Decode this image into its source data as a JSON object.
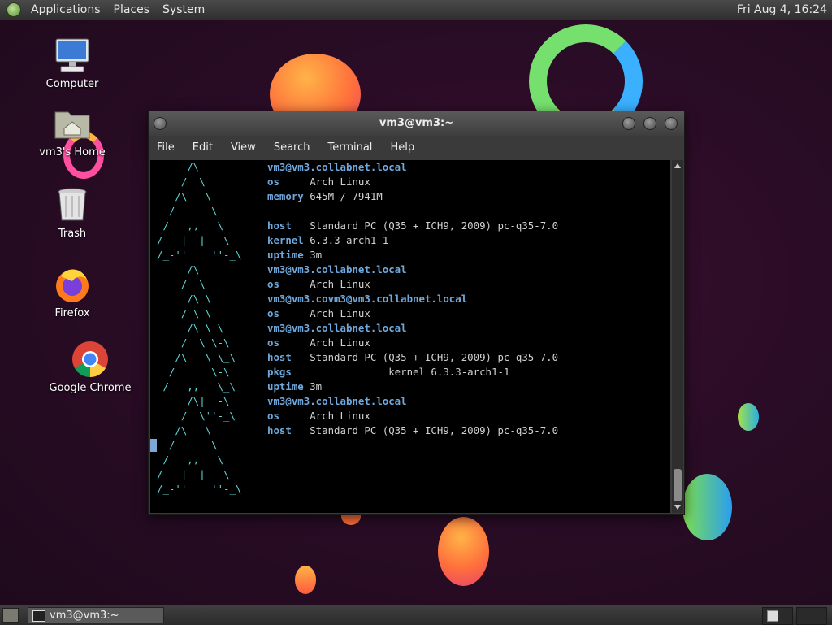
{
  "top_panel": {
    "menus": [
      "Applications",
      "Places",
      "System"
    ],
    "clock": "Fri Aug  4, 16:24"
  },
  "desktop_icons": [
    {
      "label": "Computer",
      "icon": "computer-icon"
    },
    {
      "label": "vm3's Home",
      "icon": "home-folder-icon"
    },
    {
      "label": "Trash",
      "icon": "trash-icon"
    },
    {
      "label": "Firefox",
      "icon": "firefox-icon"
    },
    {
      "label": "Google Chrome",
      "icon": "chrome-icon"
    }
  ],
  "window": {
    "title": "vm3@vm3:~",
    "menus": [
      "File",
      "Edit",
      "View",
      "Search",
      "Terminal",
      "Help"
    ]
  },
  "terminal_lines": [
    {
      "art": "     /\\",
      "key": "vm3@vm3.collabnet.local",
      "val": ""
    },
    {
      "art": "    /  \\",
      "key": "os",
      "val": "     Arch Linux"
    },
    {
      "art": "   /\\   \\",
      "key": "memory",
      "val": " 645M / 7941M"
    },
    {
      "art": "  /      \\",
      "key": "",
      "val": ""
    },
    {
      "art": " /   ,,   \\",
      "key": "host",
      "val": "   Standard PC (Q35 + ICH9, 2009) pc-q35-7.0"
    },
    {
      "art": "/   |  |  -\\",
      "key": "kernel",
      "val": " 6.3.3-arch1-1"
    },
    {
      "art": "/_-''    ''-_\\",
      "key": "uptime",
      "val": " 3m"
    },
    {
      "art": "     /\\",
      "key": "vm3@vm3.collabnet.local",
      "val": ""
    },
    {
      "art": "    /  \\",
      "key": "os",
      "val": "     Arch Linux"
    },
    {
      "art": "     /\\ \\",
      "key": "vm3@vm3.covm3@vm3.collabnet.local",
      "val": ""
    },
    {
      "art": "    / \\ \\",
      "key": "os",
      "val": "     Arch Linux"
    },
    {
      "art": "     /\\ \\ \\",
      "key": "vm3@vm3.collabnet.local",
      "val": ""
    },
    {
      "art": "    /  \\ \\-\\",
      "key": "os",
      "val": "     Arch Linux"
    },
    {
      "art": "   /\\   \\ \\_\\",
      "key": "host",
      "val": "   Standard PC (Q35 + ICH9, 2009) pc-q35-7.0"
    },
    {
      "art": "  /      \\-\\",
      "key": "pkgs",
      "val": "                kernel 6.3.3-arch1-1"
    },
    {
      "art": " /   ,,   \\_\\",
      "key": "uptime",
      "val": " 3m"
    },
    {
      "art": "     /\\|  -\\",
      "key": "vm3@vm3.collabnet.local",
      "val": ""
    },
    {
      "art": "    /  \\''-_\\",
      "key": "os",
      "val": "     Arch Linux"
    },
    {
      "art": "   /\\   \\",
      "key": "host",
      "val": "   Standard PC (Q35 + ICH9, 2009) pc-q35-7.0"
    },
    {
      "art": "  /      \\",
      "key": "",
      "val": ""
    },
    {
      "art": " /   ,,   \\",
      "key": "",
      "val": ""
    },
    {
      "art": "/   |  |  -\\",
      "key": "",
      "val": ""
    },
    {
      "art": "/_-''    ''-_\\",
      "key": "",
      "val": ""
    }
  ],
  "taskbar": {
    "task_label": "vm3@vm3:~"
  },
  "colors": {
    "background": "#2a0c26",
    "terminal_bg": "#000000",
    "terminal_key": "#6fa8dc",
    "terminal_art": "#5fd7d7"
  }
}
